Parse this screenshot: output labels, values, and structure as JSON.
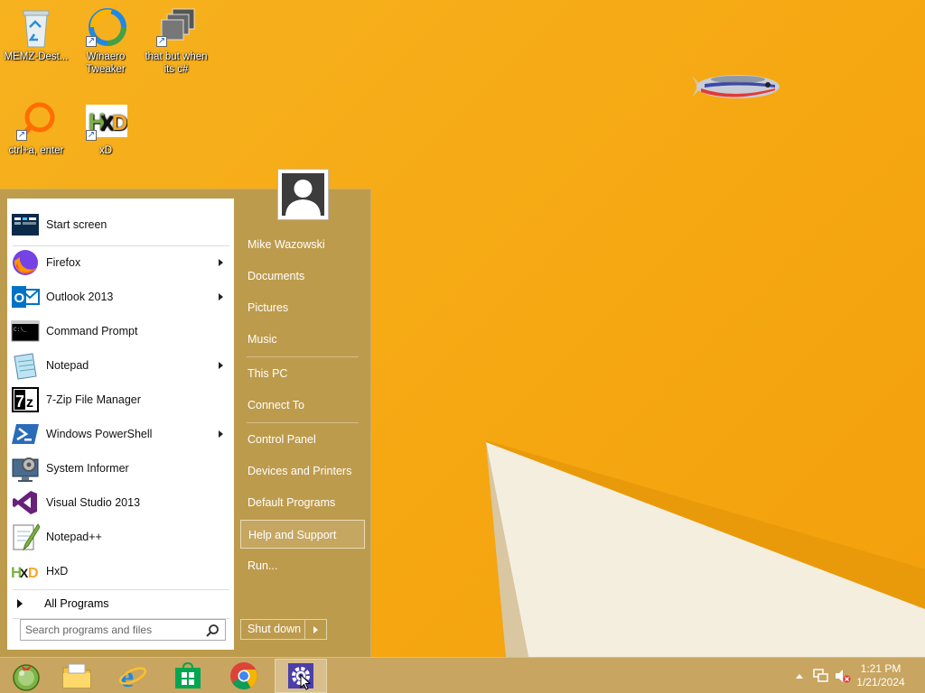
{
  "desktop": {
    "icons": [
      {
        "label": "MEMZ-Dest...",
        "icon": "recycle-bin-icon"
      },
      {
        "label": "Winaero Tweaker",
        "icon": "winaero-icon"
      },
      {
        "label": "that but when its c#",
        "icon": "stacked-windows-icon"
      },
      {
        "label": "ctrl+a, enter",
        "icon": "magnifier-icon"
      },
      {
        "label": "xD",
        "icon": "hxd-icon"
      }
    ]
  },
  "start_menu": {
    "programs": [
      {
        "label": "Start screen",
        "icon": "start-screen-icon",
        "submenu": false
      },
      {
        "label": "Firefox",
        "icon": "firefox-icon",
        "submenu": true
      },
      {
        "label": "Outlook 2013",
        "icon": "outlook-icon",
        "submenu": true
      },
      {
        "label": "Command Prompt",
        "icon": "command-prompt-icon",
        "submenu": false
      },
      {
        "label": "Notepad",
        "icon": "notepad-icon",
        "submenu": true
      },
      {
        "label": "7-Zip File Manager",
        "icon": "7zip-icon",
        "submenu": false
      },
      {
        "label": "Windows PowerShell",
        "icon": "powershell-icon",
        "submenu": true
      },
      {
        "label": "System Informer",
        "icon": "system-informer-icon",
        "submenu": false
      },
      {
        "label": "Visual Studio 2013",
        "icon": "visual-studio-icon",
        "submenu": false
      },
      {
        "label": "Notepad++",
        "icon": "notepadpp-icon",
        "submenu": false
      },
      {
        "label": "HxD",
        "icon": "hxd-icon",
        "submenu": false
      }
    ],
    "all_programs": "All Programs",
    "search_placeholder": "Search programs and files",
    "right_links": [
      {
        "label": "Mike Wazowski"
      },
      {
        "label": "Documents"
      },
      {
        "label": "Pictures"
      },
      {
        "label": "Music"
      },
      {
        "label": "This PC"
      },
      {
        "label": "Connect To"
      },
      {
        "label": "Control Panel"
      },
      {
        "label": "Devices and Printers"
      },
      {
        "label": "Default Programs"
      },
      {
        "label": "Help and Support",
        "highlighted": true
      },
      {
        "label": "Run..."
      }
    ],
    "shutdown_label": "Shut down"
  },
  "taskbar": {
    "buttons": [
      {
        "icon": "start-orb-icon"
      },
      {
        "icon": "file-explorer-icon"
      },
      {
        "icon": "internet-explorer-icon"
      },
      {
        "icon": "windows-store-icon"
      },
      {
        "icon": "chrome-icon"
      },
      {
        "icon": "settings-gear-icon",
        "active": true
      }
    ],
    "tray_icons": [
      "show-hidden-icons-icon",
      "network-icon",
      "volume-muted-icon"
    ],
    "time": "1:21 PM",
    "date": "1/21/2024"
  },
  "colors": {
    "accent": "#b89a52",
    "wallpaper": "#f5ab19"
  }
}
